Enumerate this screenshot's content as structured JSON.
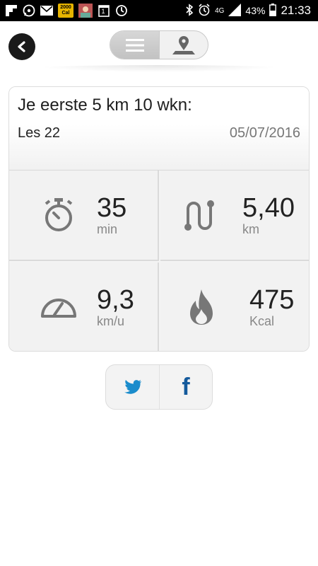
{
  "status_bar": {
    "battery_percent": "43%",
    "network": "4G",
    "time": "21:33",
    "notification_icons": [
      "flipboard-icon",
      "whatsapp-icon",
      "mail-icon",
      "calorie-app-icon",
      "photo-icon",
      "calendar-icon",
      "sync-icon"
    ],
    "calorie_badge_top": "2000",
    "calorie_badge_bottom": "Cal",
    "calendar_day": "1"
  },
  "header": {
    "back_label": "<",
    "segments": [
      {
        "icon": "list-icon",
        "active": true
      },
      {
        "icon": "map-pin-icon",
        "active": false
      }
    ]
  },
  "workout": {
    "title": "Je eerste 5 km 10 wkn:",
    "lesson": "Les 22",
    "date": "05/07/2016",
    "stats": {
      "duration": {
        "value": "35",
        "unit": "min",
        "icon": "stopwatch-icon"
      },
      "distance": {
        "value": "5,40",
        "unit": "km",
        "icon": "route-icon"
      },
      "speed": {
        "value": "9,3",
        "unit": "km/u",
        "icon": "speedometer-icon"
      },
      "calories": {
        "value": "475",
        "unit": "Kcal",
        "icon": "flame-icon"
      }
    }
  },
  "share": [
    {
      "icon": "twitter-icon",
      "color": "#1a8ccc"
    },
    {
      "icon": "facebook-icon",
      "glyph": "f",
      "color": "#145a9c"
    }
  ]
}
